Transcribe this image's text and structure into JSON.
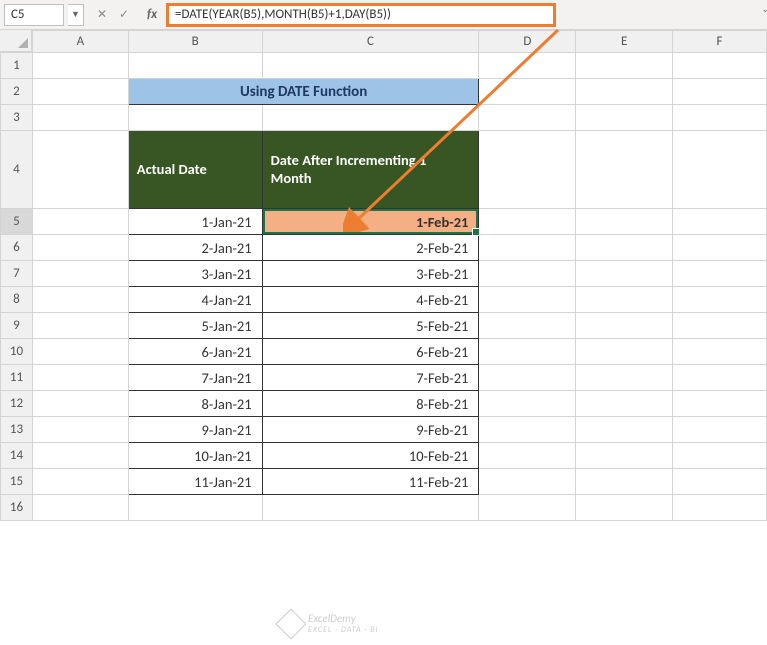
{
  "nameBox": "C5",
  "formula": "=DATE(YEAR(B5),MONTH(B5)+1,DAY(B5))",
  "columns": [
    "A",
    "B",
    "C",
    "D",
    "E",
    "F"
  ],
  "rows": [
    1,
    2,
    3,
    4,
    5,
    6,
    7,
    8,
    9,
    10,
    11,
    12,
    13,
    14,
    15,
    16
  ],
  "title": "Using DATE Function",
  "headers": {
    "b": "Actual Date",
    "c": "Date After Incrementing 1 Month"
  },
  "data": [
    {
      "b": "1-Jan-21",
      "c": "1-Feb-21"
    },
    {
      "b": "2-Jan-21",
      "c": "2-Feb-21"
    },
    {
      "b": "3-Jan-21",
      "c": "3-Feb-21"
    },
    {
      "b": "4-Jan-21",
      "c": "4-Feb-21"
    },
    {
      "b": "5-Jan-21",
      "c": "5-Feb-21"
    },
    {
      "b": "6-Jan-21",
      "c": "6-Feb-21"
    },
    {
      "b": "7-Jan-21",
      "c": "7-Feb-21"
    },
    {
      "b": "8-Jan-21",
      "c": "8-Feb-21"
    },
    {
      "b": "9-Jan-21",
      "c": "9-Feb-21"
    },
    {
      "b": "10-Jan-21",
      "c": "10-Feb-21"
    },
    {
      "b": "11-Jan-21",
      "c": "11-Feb-21"
    }
  ],
  "watermark": {
    "brand": "ExcelDemy",
    "sub": "EXCEL · DATA · BI"
  }
}
